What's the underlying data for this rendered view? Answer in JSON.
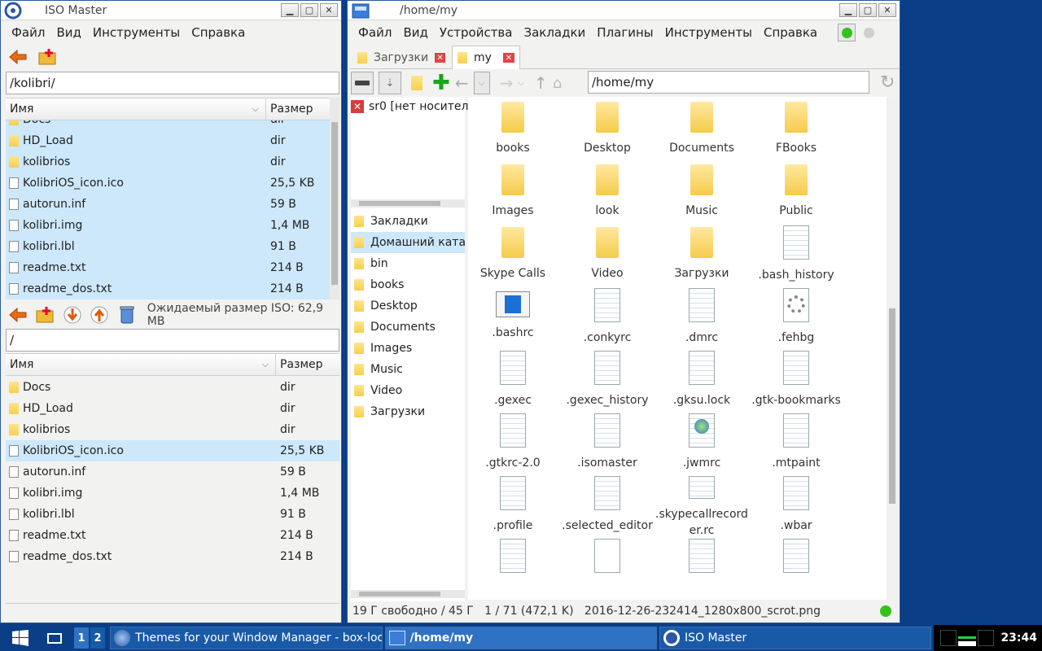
{
  "iso": {
    "title": "ISO Master",
    "menu": [
      "Файл",
      "Вид",
      "Инструменты",
      "Справка"
    ],
    "fs_path": "/kolibri/",
    "fs_headers": {
      "name": "Имя",
      "size": "Размер"
    },
    "fs_rows": [
      {
        "name": "Docs",
        "size": "dir",
        "t": "folder"
      },
      {
        "name": "HD_Load",
        "size": "dir",
        "t": "folder"
      },
      {
        "name": "kolibrios",
        "size": "dir",
        "t": "folder"
      },
      {
        "name": "KolibriOS_icon.ico",
        "size": "25,5 KB",
        "t": "file"
      },
      {
        "name": "autorun.inf",
        "size": "59 B",
        "t": "file"
      },
      {
        "name": "kolibri.img",
        "size": "1,4 MB",
        "t": "file"
      },
      {
        "name": "kolibri.lbl",
        "size": "91 B",
        "t": "file"
      },
      {
        "name": "readme.txt",
        "size": "214 B",
        "t": "file"
      },
      {
        "name": "readme_dos.txt",
        "size": "214 B",
        "t": "file"
      }
    ],
    "iso_size_label": "Ожидаемый размер ISO: 62,9 MB",
    "iso_path": "/",
    "iso_headers": {
      "name": "Имя",
      "size": "Размер"
    },
    "iso_rows": [
      {
        "name": "Docs",
        "size": "dir",
        "t": "folder"
      },
      {
        "name": "HD_Load",
        "size": "dir",
        "t": "folder"
      },
      {
        "name": "kolibrios",
        "size": "dir",
        "t": "folder"
      },
      {
        "name": "KolibriOS_icon.ico",
        "size": "25,5 KB",
        "t": "file"
      },
      {
        "name": "autorun.inf",
        "size": "59 B",
        "t": "file"
      },
      {
        "name": "kolibri.img",
        "size": "1,4 MB",
        "t": "file"
      },
      {
        "name": "kolibri.lbl",
        "size": "91 B",
        "t": "file"
      },
      {
        "name": "readme.txt",
        "size": "214 B",
        "t": "file"
      },
      {
        "name": "readme_dos.txt",
        "size": "214 B",
        "t": "file"
      }
    ]
  },
  "fm": {
    "title": "/home/my",
    "menu": [
      "Файл",
      "Вид",
      "Устройства",
      "Закладки",
      "Плагины",
      "Инструменты",
      "Справка"
    ],
    "tabs": [
      {
        "label": "Загрузки"
      },
      {
        "label": "my"
      }
    ],
    "path": "/home/my",
    "device": "sr0 [нет носител",
    "side": [
      "Закладки",
      "Домашний ката",
      "bin",
      "books",
      "Desktop",
      "Documents",
      "Images",
      "Music",
      "Video",
      "Загрузки"
    ],
    "icons": [
      {
        "l": "books",
        "t": "f"
      },
      {
        "l": "Desktop",
        "t": "f"
      },
      {
        "l": "Documents",
        "t": "f"
      },
      {
        "l": "FBooks",
        "t": "f"
      },
      {
        "l": "Images",
        "t": "f"
      },
      {
        "l": "look",
        "t": "f"
      },
      {
        "l": "Music",
        "t": "f"
      },
      {
        "l": "Public",
        "t": "f"
      },
      {
        "l": "Skype Calls",
        "t": "f"
      },
      {
        "l": "Video",
        "t": "f"
      },
      {
        "l": "Загрузки",
        "t": "f"
      },
      {
        "l": ".bash_history",
        "t": "d"
      },
      {
        "l": ".bashrc",
        "t": "w"
      },
      {
        "l": ".conkyrc",
        "t": "d"
      },
      {
        "l": ".dmrc",
        "t": "d"
      },
      {
        "l": ".fehbg",
        "t": "g"
      },
      {
        "l": ".gexec",
        "t": "d"
      },
      {
        "l": ".gexec_history",
        "t": "d"
      },
      {
        "l": ".gksu.lock",
        "t": "d"
      },
      {
        "l": ".gtk-bookmarks",
        "t": "d"
      },
      {
        "l": ".gtkrc-2.0",
        "t": "d"
      },
      {
        "l": ".isomaster",
        "t": "d"
      },
      {
        "l": ".jwmrc",
        "t": "x"
      },
      {
        "l": ".mtpaint",
        "t": "d"
      },
      {
        "l": ".profile",
        "t": "d"
      },
      {
        "l": ".selected_editor",
        "t": "d"
      },
      {
        "l": ".skypecallrecorder.rc",
        "t": "d"
      },
      {
        "l": ".wbar",
        "t": "d"
      },
      {
        "l": "",
        "t": "d"
      },
      {
        "l": "",
        "t": "b"
      },
      {
        "l": "",
        "t": "d"
      },
      {
        "l": "",
        "t": "d"
      }
    ],
    "status": "19 Г свободно / 45 Г   1 / 71 (472,1 K)   2016-12-26-232414_1280x800_scrot.png"
  },
  "taskbar": {
    "ws": [
      "1",
      "2"
    ],
    "tasks": [
      "Themes for your Window Manager - box-look.org - ...",
      "/home/my",
      "ISO Master"
    ],
    "clock": "23:44"
  },
  "colors": {
    "selection": "#cde8fb",
    "desktop": "#0a3f87",
    "title_bar": "#ffffff"
  }
}
